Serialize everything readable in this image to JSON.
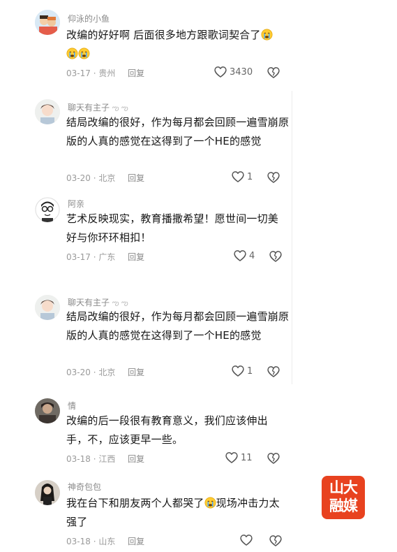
{
  "comments": [
    {
      "username": "仰泳的小鱼",
      "text": "改编的好好啊 后面很多地方跟歌词契合了",
      "date": "03-17",
      "location": "贵州",
      "reply": "回复",
      "likes": "3430",
      "emoji_count": 2
    },
    {
      "username": "聊天有主子",
      "text": "结局改编的很好，作为每月都会回顾一遍雪崩原版的人真的感觉在这得到了一个HE的感觉",
      "date": "03-20",
      "location": "北京",
      "reply": "回复",
      "likes": "1"
    },
    {
      "username": "阿亲",
      "text": "艺术反映现实，教育播撒希望！愿世间一切美好与你环环相扣！",
      "date": "03-17",
      "location": "广东",
      "reply": "回复",
      "likes": "4"
    },
    {
      "username": "聊天有主子",
      "text": "结局改编的很好，作为每月都会回顾一遍雪崩原版的人真的感觉在这得到了一个HE的感觉",
      "date": "03-20",
      "location": "北京",
      "reply": "回复",
      "likes": "1"
    },
    {
      "username": "情",
      "text": "改编的后一段很有教育意义，我们应该伸出手，不，应该更早一些。",
      "date": "03-18",
      "location": "江西",
      "reply": "回复",
      "likes": "11"
    },
    {
      "username": "神奇包包",
      "text_before": "我在台下和朋友两个人都哭了",
      "text_after": "现场冲击力太强了",
      "date": "03-18",
      "location": "山东",
      "reply": "回复",
      "likes": ""
    }
  ],
  "watermark": {
    "line1": "山大",
    "line2": "融媒"
  },
  "colors": {
    "logo_bg": "#e8421f",
    "text": "#161616",
    "muted": "#9a9a9a"
  },
  "icons": {
    "like": "heart-outline-icon",
    "dislike": "broken-heart-icon",
    "emoji": "crying-face-emoji"
  }
}
